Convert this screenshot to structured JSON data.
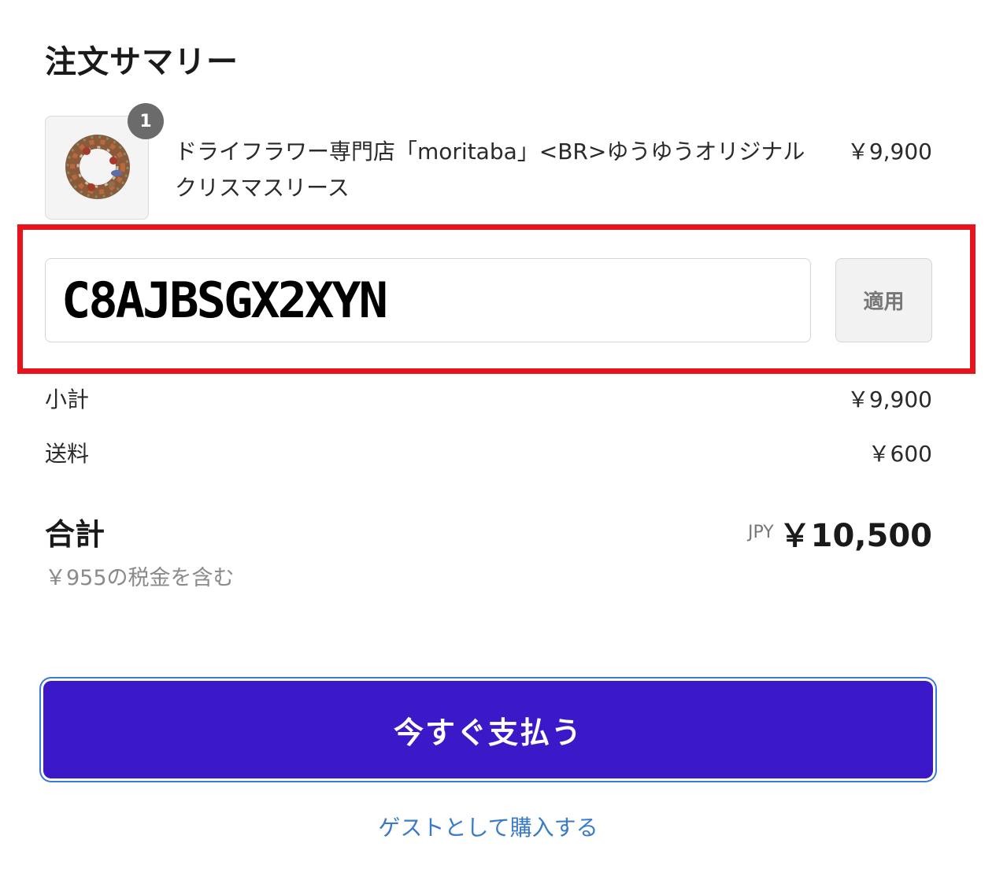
{
  "summary": {
    "title": "注文サマリー"
  },
  "product": {
    "quantity": "1",
    "name": "ドライフラワー専門店「moritaba」<BR>ゆうゆうオリジナル　クリスマスリース",
    "price": "￥9,900",
    "thumbnail_icon": "wreath-image"
  },
  "discount": {
    "value": "C8AJBSGX2XYN",
    "apply_label": "適用",
    "highlight_color": "#e8141b"
  },
  "subtotal": {
    "label": "小計",
    "value": "￥9,900"
  },
  "shipping": {
    "label": "送料",
    "value": "￥600"
  },
  "total": {
    "label": "合計",
    "currency": "JPY",
    "value": "￥10,500",
    "tax_note": "￥955の税金を含む"
  },
  "actions": {
    "pay_now_label": "今すぐ支払う",
    "pay_button_color": "#3b18c8",
    "guest_checkout_label": "ゲストとして購入する",
    "link_color": "#3a7bc8"
  }
}
